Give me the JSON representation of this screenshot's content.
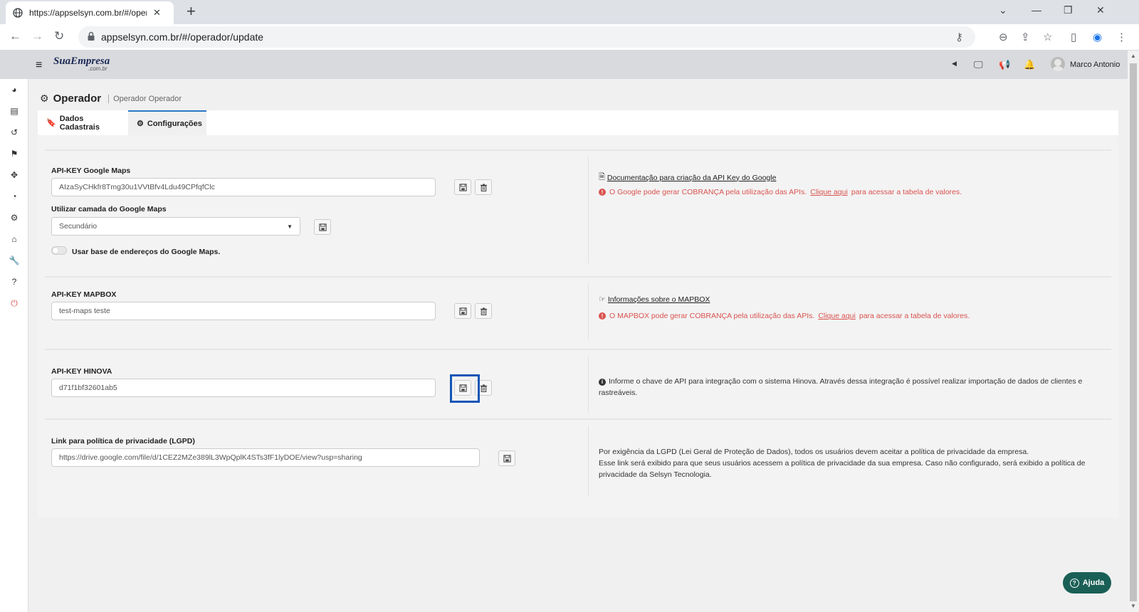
{
  "browser": {
    "tab_title": "https://appselsyn.com.br/#/oper",
    "url": "appselsyn.com.br/#/operador/update"
  },
  "header": {
    "logo": "SuaEmpresa",
    "logo_sub": ".com.br",
    "user_name": "Marco Antonio"
  },
  "page": {
    "title": "Operador",
    "subtitle": "Operador Operador"
  },
  "tabs": [
    {
      "label": "Dados Cadastrais"
    },
    {
      "label": "Configurações"
    }
  ],
  "google": {
    "api_label": "API-KEY Google Maps",
    "api_value": "AIzaSyCHkfr8Tmg30u1VVtBfv4Ldu49CPfqfClc",
    "layer_label": "Utilizar camada do Google Maps",
    "layer_value": "Secundário",
    "toggle_label": "Usar base de endereços do Google Maps.",
    "doc_link": "Documentação para criação da API Key do Google",
    "warn_text": "O Google pode gerar COBRANÇA pela utilização das APIs.",
    "warn_link": "Clique aqui",
    "warn_suffix": "para acessar a tabela de valores."
  },
  "mapbox": {
    "api_label": "API-KEY MAPBOX",
    "api_value": "test-maps teste",
    "info_link": "Informações sobre o MAPBOX",
    "warn_text": "O MAPBOX pode gerar COBRANÇA pela utilização das APIs.",
    "warn_link": "Clique aqui",
    "warn_suffix": "para acessar a tabela de valores."
  },
  "hinova": {
    "api_label": "API-KEY HINOVA",
    "api_value": "d71f1bf32601ab5",
    "info_text": "Informe o chave de API para integração com o sistema Hinova. Através dessa integração é possível realizar importação de dados de clientes e rastreáveis."
  },
  "lgpd": {
    "label": "Link para política de privacidade (LGPD)",
    "value": "https://drive.google.com/file/d/1CEZ2MZe389lL3WpQplK4STs3fF1lyDOE/view?usp=sharing",
    "info_line1": "Por exigência da LGPD (Lei Geral de Proteção de Dados), todos os usuários devem aceitar a política de privacidade da empresa.",
    "info_line2": "Esse link será exibido para que seus usuários acessem a política de privacidade da sua empresa. Caso não configurado, será exibido a política de privacidade da Selsyn Tecnologia."
  },
  "help_label": "Ajuda",
  "colors": {
    "accent": "#2a78c4",
    "warning": "#d9534f",
    "help_button": "#1a5f56",
    "highlight": "#1455b6"
  }
}
